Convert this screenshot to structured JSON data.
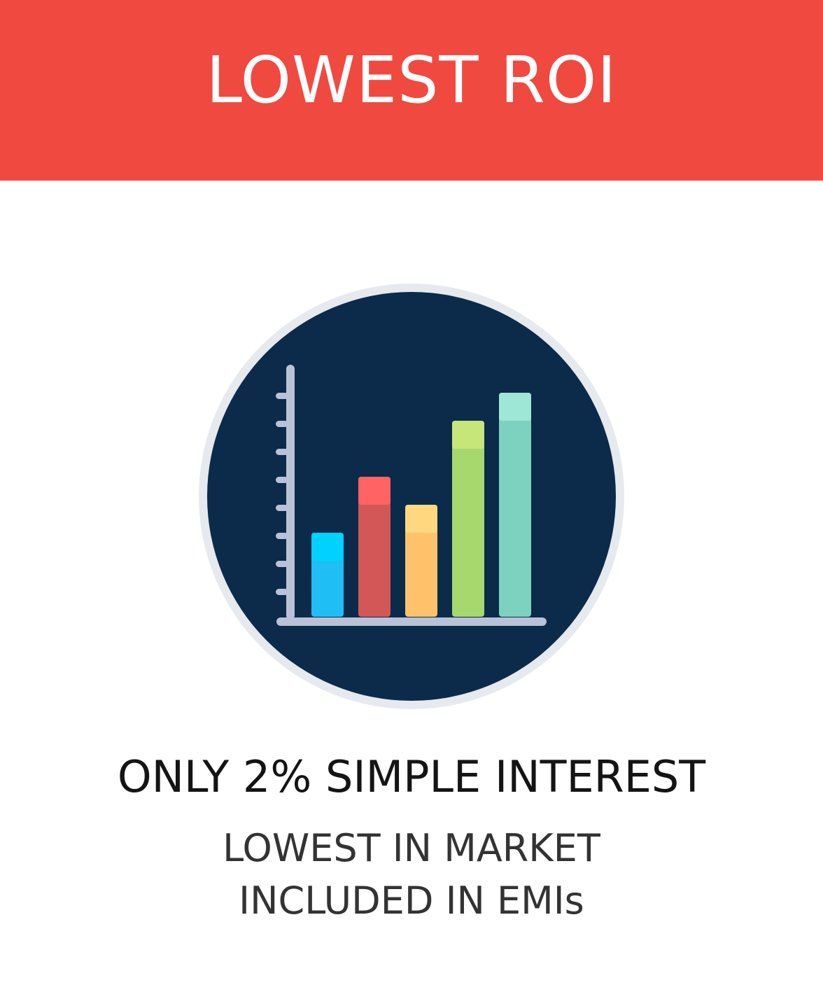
{
  "banner": {
    "title": "LOWEST ROI"
  },
  "illustration": {
    "icon": "bar-chart-icon",
    "bar_levels": [
      0.3,
      0.5,
      0.4,
      0.7,
      0.8
    ],
    "bar_colors": [
      "#1FBEF4",
      "#D35757",
      "#FEC36A",
      "#A6D86E",
      "#7CD2BF"
    ],
    "bar_cap_colors": [
      "#00D2FF",
      "#FF6363",
      "#FFD77F",
      "#C6E679",
      "#9EE7D6"
    ]
  },
  "headline": "ONLY 2% SIMPLE INTEREST",
  "subtext": {
    "line1": "LOWEST IN MARKET",
    "line2": "INCLUDED IN EMIs"
  },
  "colors": {
    "banner": "#F04940",
    "circle": "#0C2A4A",
    "ring": "#E6E9EE",
    "axis": "#B9C2D8"
  }
}
